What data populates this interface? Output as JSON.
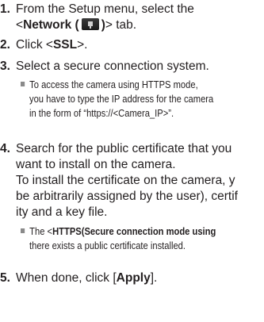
{
  "steps": [
    {
      "number": "1.",
      "line1": "From the Setup menu, select the",
      "line2_prefix": "<",
      "line2_bold": "Network (",
      "icon": "network-setup-icon",
      "line2_bold_close": ")",
      "line2_suffix": "> tab."
    },
    {
      "number": "2.",
      "prefix": "Click <",
      "bold": "SSL",
      "suffix": ">."
    },
    {
      "number": "3.",
      "text": "Select a secure connection system.",
      "note_lines": [
        "To access the camera using HTTPS mode,",
        "you have to type the IP address for the camera",
        "in the form of “https://<Camera_IP>”."
      ]
    },
    {
      "number": "4.",
      "lines": [
        "Search for the public certificate that you",
        "want to install on the camera.",
        "To install the certificate on the camera, y",
        "be arbitrarily assigned by the user), certif",
        "ity and a key file."
      ],
      "note_prefix": "The <",
      "note_bold": "HTTPS(Secure connection mode using",
      "note_line2": "there exists a public certificate installed."
    },
    {
      "number": "5.",
      "prefix": "When done, click [",
      "bold": "Apply",
      "suffix": "]."
    }
  ]
}
